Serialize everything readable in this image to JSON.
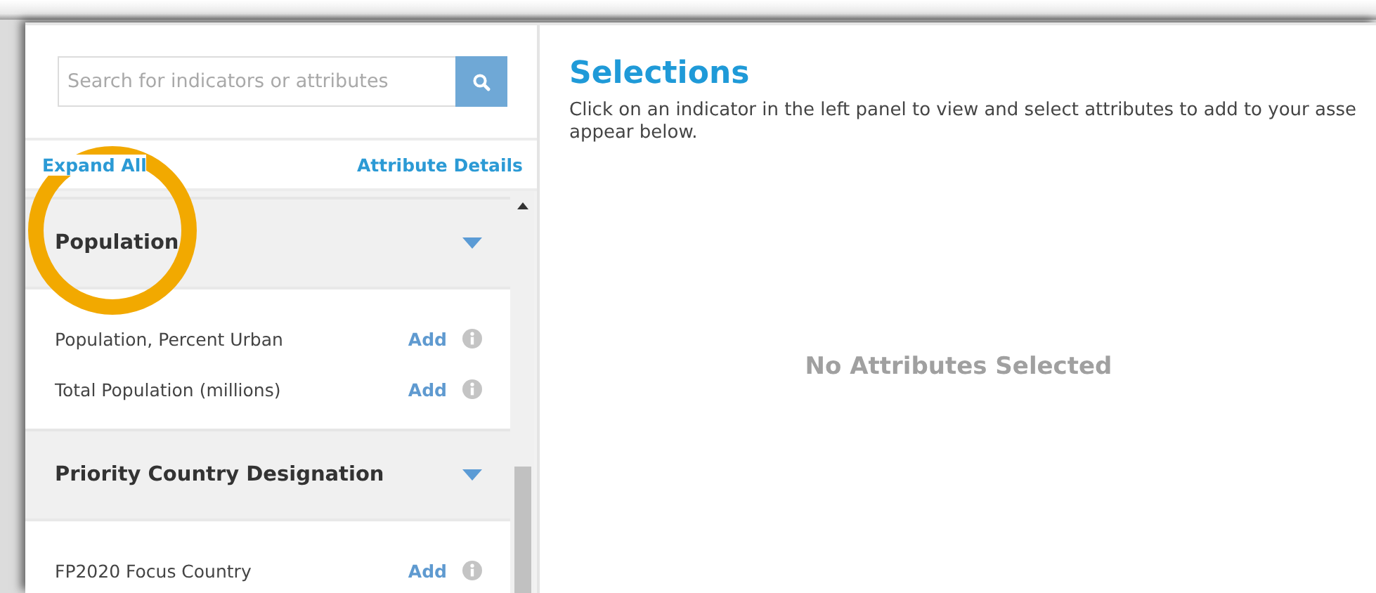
{
  "search": {
    "placeholder": "Search for indicators or attributes"
  },
  "links": [
    "Expand All",
    "Attribute Details"
  ],
  "indicators": [
    {
      "title": "Population",
      "expanded": true,
      "attributes": [
        {
          "label": "Population, Percent Urban",
          "action": "Add"
        },
        {
          "label": "Total Population (millions)",
          "action": "Add"
        }
      ]
    },
    {
      "title": "Priority Country Designation",
      "expanded": true,
      "attributes": [
        {
          "label": "FP2020 Focus Country",
          "action": "Add"
        }
      ]
    }
  ],
  "selections": {
    "title": "Selections",
    "description_lines": [
      "Click on an indicator in the left panel to view and select attributes to add to your asse",
      "appear below."
    ],
    "empty_message": "No Attributes Selected"
  },
  "highlight": {
    "kind": "circle",
    "color": "#f2a900"
  }
}
